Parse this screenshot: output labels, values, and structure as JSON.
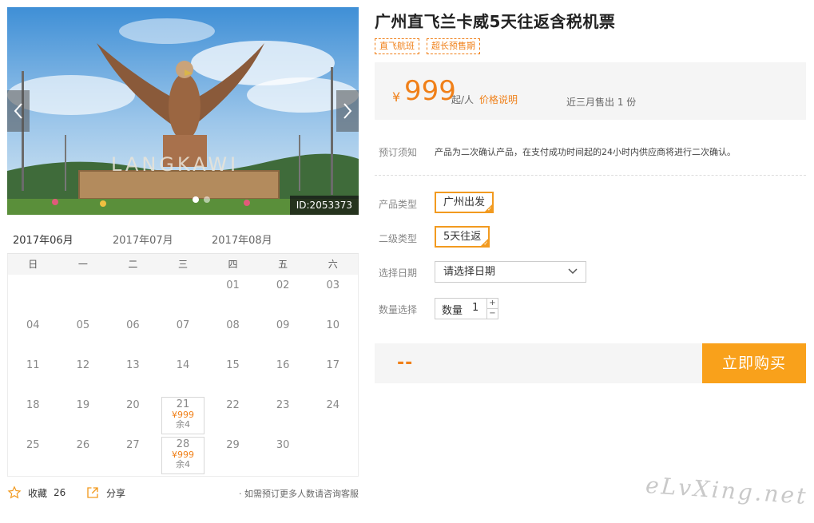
{
  "product": {
    "title": "广州直飞兰卡威5天往返含税机票",
    "tags": [
      "直飞航班",
      "超长预售期"
    ]
  },
  "gallery": {
    "id_label": "ID:2053373",
    "sign_text": "LANGKAWI",
    "dots": 2,
    "active_dot": 0,
    "prev_icon": "chevron-left-icon",
    "next_icon": "chevron-right-icon"
  },
  "price": {
    "currency": "¥",
    "value": "999",
    "unit": "起/人",
    "explain_link": "价格说明",
    "sold": "近三月售出 1 份"
  },
  "notice": {
    "label": "预订须知",
    "text": "产品为二次确认产品，在支付成功时间起的24小时内供应商将进行二次确认。"
  },
  "options": {
    "type_label": "产品类型",
    "type_value": "广州出发",
    "subtype_label": "二级类型",
    "subtype_value": "5天往返",
    "date_label": "选择日期",
    "date_placeholder": "请选择日期",
    "qty_label": "数量选择",
    "qty_prefix": "数量",
    "qty_value": "1",
    "qty_plus": "+",
    "qty_minus": "−"
  },
  "buy": {
    "total": "--",
    "button": "立即购买"
  },
  "calendar": {
    "months": [
      "2017年06月",
      "2017年07月",
      "2017年08月"
    ],
    "active_month": 0,
    "weekdays": [
      "日",
      "一",
      "二",
      "三",
      "四",
      "五",
      "六"
    ],
    "first_weekday": 4,
    "days_in_month": 30,
    "available": [
      {
        "day": "21",
        "price": "¥999",
        "stock": "余4"
      },
      {
        "day": "28",
        "price": "¥999",
        "stock": "余4"
      }
    ]
  },
  "footer": {
    "fav_label": "收藏",
    "fav_count": "26",
    "share_label": "分享",
    "note": "· 如需预订更多人数请咨询客服"
  },
  "watermark": "eLvXing.net",
  "colors": {
    "accent": "#f08019",
    "button": "#f9a11b"
  }
}
